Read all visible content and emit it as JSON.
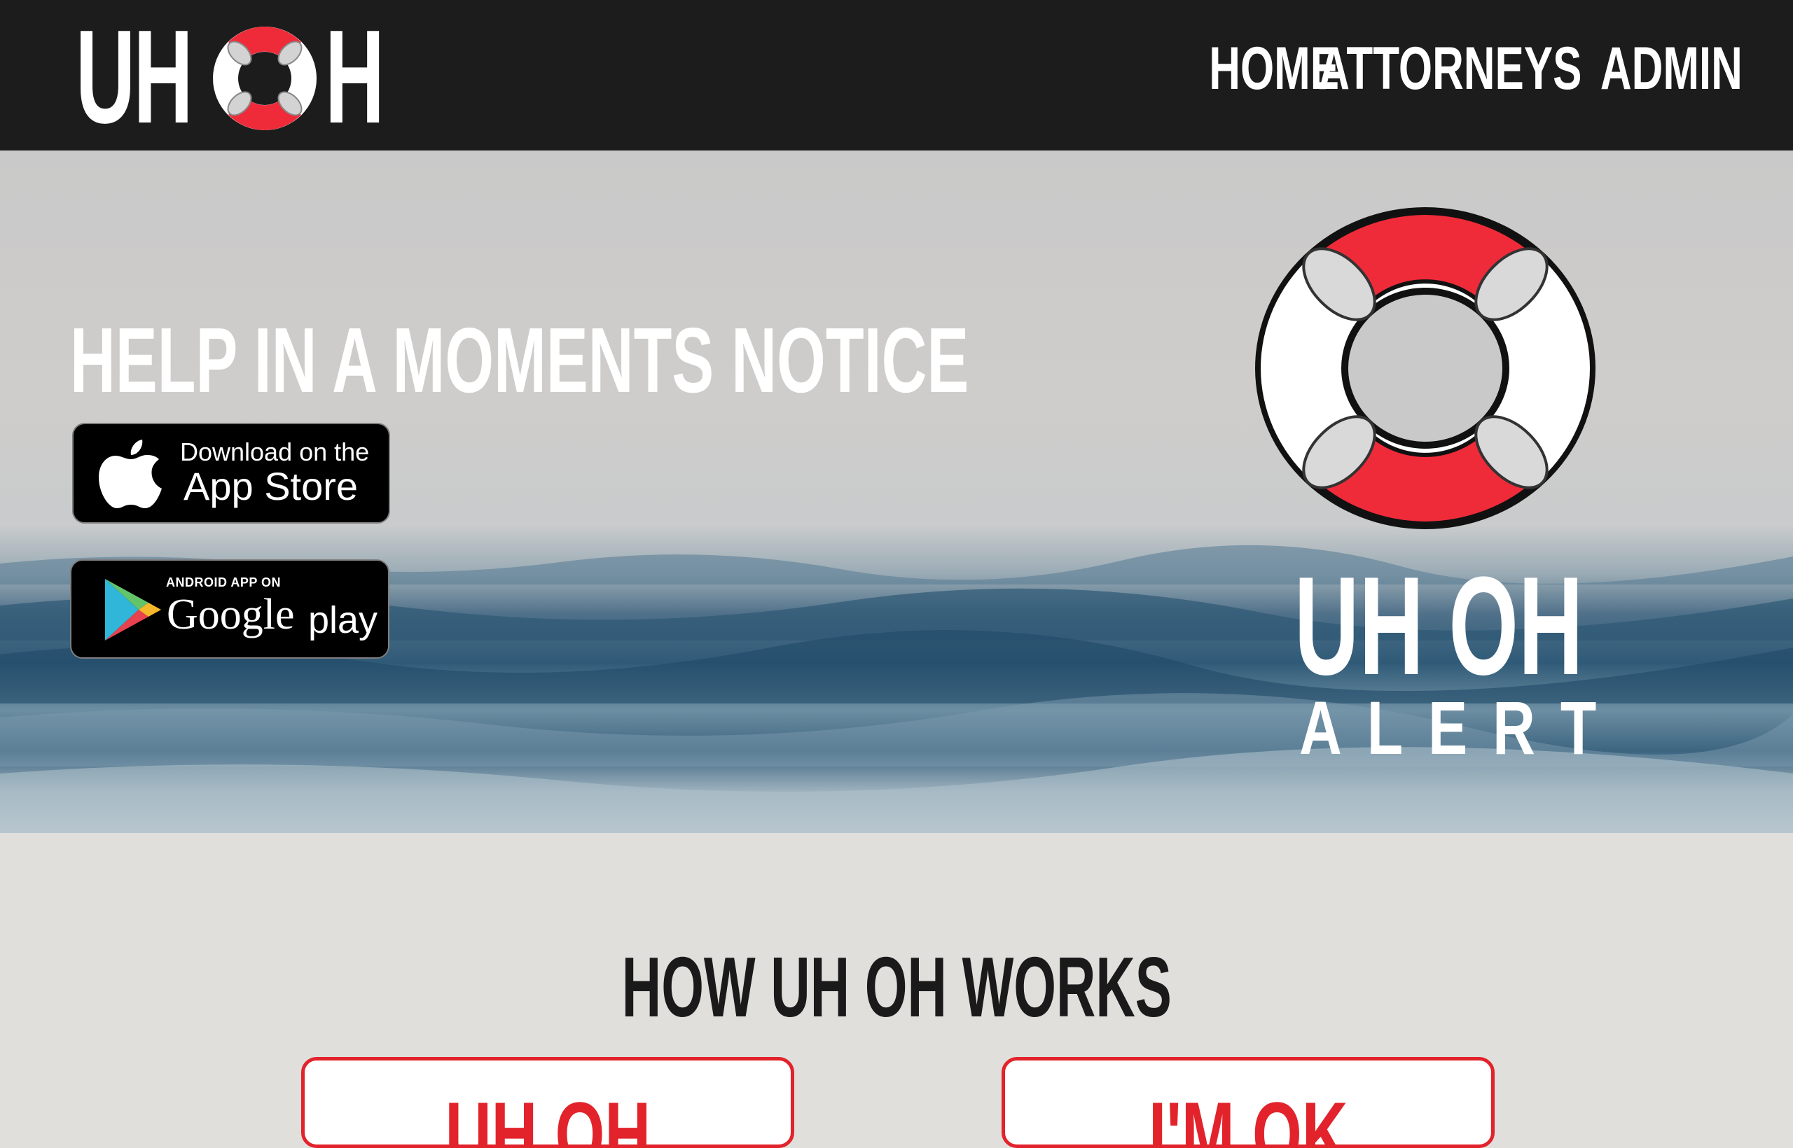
{
  "nav": {
    "logo_left": "UH",
    "logo_right": "H",
    "links": [
      "HOME",
      "ATTORNEYS",
      "ADMIN"
    ]
  },
  "hero": {
    "title": "HELP IN A MOMENTS NOTICE",
    "app_store": {
      "small": "Download on the",
      "big": "App Store"
    },
    "google_play": {
      "small": "ANDROID APP ON",
      "big": "Google",
      "big2": "play"
    },
    "alert_title": "UH OH",
    "alert_sub": "ALERT"
  },
  "section": {
    "title": "HOW UH OH WORKS",
    "cards": [
      "UH OH",
      "I'M OK"
    ]
  },
  "colors": {
    "brand_red": "#ef2b3a",
    "nav_bg": "#1c1c1c",
    "card_red": "#e2232b"
  }
}
